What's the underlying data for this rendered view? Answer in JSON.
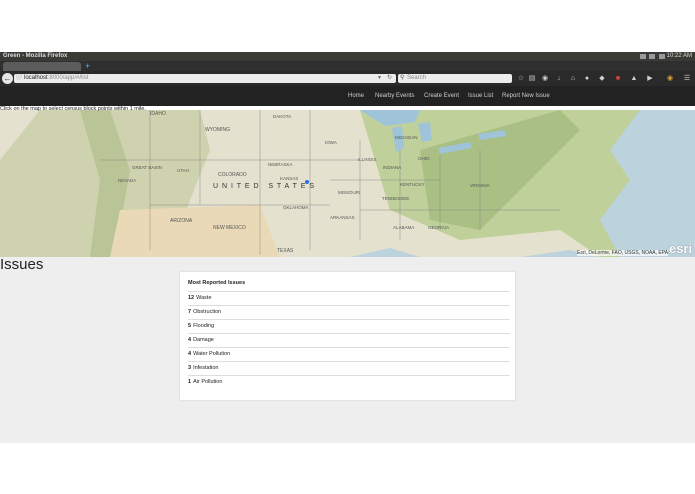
{
  "window": {
    "title": "Green - Mozilla Firefox",
    "clock": "10:22 AM"
  },
  "browser": {
    "new_tab": "+",
    "url_host": "localhost",
    "url_path": ":8000/app/#/list",
    "search_placeholder": "Search"
  },
  "app_nav": {
    "items": [
      "Home",
      "Nearby Events",
      "Create Event",
      "Issue List",
      "Report New Issue"
    ]
  },
  "map": {
    "hint": "Click on the map to select census block points within 1 mile.",
    "country_label": "U N I T E D   S T A T E S",
    "state_labels": [
      "IDAHO",
      "WYOMING",
      "NEBRASKA",
      "COLORADO",
      "KANSAS",
      "GREAT BASIN",
      "NEVADA",
      "UTAH",
      "ARIZONA",
      "NEW MEXICO",
      "OKLAHOMA",
      "TEXAS",
      "MISSOURI",
      "IOWA",
      "ILLINOIS",
      "OHIO",
      "MICHIGAN",
      "VIRGINIA",
      "TENNESSEE",
      "GEORGIA",
      "ALABAMA",
      "ARKANSAS",
      "KENTUCKY",
      "INDIANA",
      "DAKOTA"
    ],
    "attribution": "Esri, DeLorme, FAO, USGS, NOAA, EPA",
    "logo": "esri"
  },
  "page": {
    "heading": "Issues"
  },
  "panel": {
    "title": "Most Reported Issues",
    "rows": [
      {
        "count": "12",
        "label": "Waste"
      },
      {
        "count": "7",
        "label": "Obstruction"
      },
      {
        "count": "5",
        "label": "Flooding"
      },
      {
        "count": "4",
        "label": "Damage"
      },
      {
        "count": "4",
        "label": "Water Pollution"
      },
      {
        "count": "3",
        "label": "Infestation"
      },
      {
        "count": "1",
        "label": "Air Pollution"
      }
    ]
  }
}
